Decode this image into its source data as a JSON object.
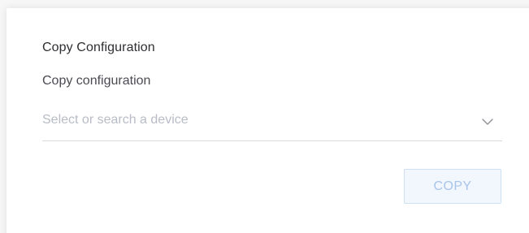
{
  "dialog": {
    "title": "Copy Configuration",
    "field_label": "Copy configuration",
    "device_select": {
      "placeholder": "Select or search a device",
      "icon": "chevron-down-icon"
    },
    "copy_button": {
      "label": "COPY",
      "state": "disabled"
    }
  },
  "colors": {
    "button_text_disabled": "#a9c4ea",
    "button_bg_disabled": "#f2f7fd",
    "placeholder_text": "#b8bcc6"
  }
}
